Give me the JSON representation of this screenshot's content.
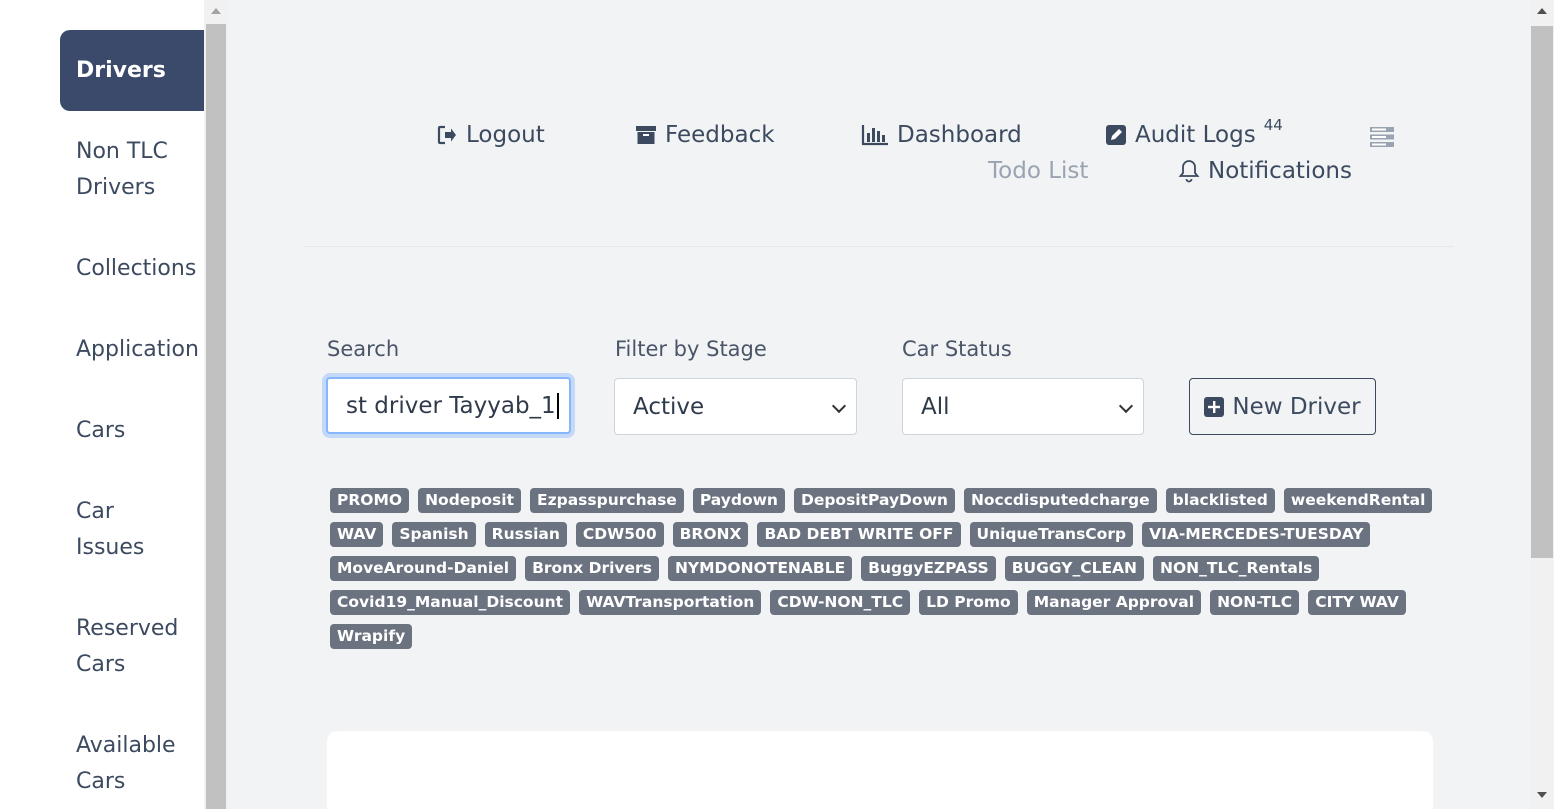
{
  "sidebar": {
    "items": [
      {
        "label": "Drivers",
        "active": true
      },
      {
        "label": "Non TLC Drivers"
      },
      {
        "label": "Collections"
      },
      {
        "label": "Application"
      },
      {
        "label": "Cars"
      },
      {
        "label": "Car Issues"
      },
      {
        "label": "Reserved Cars"
      },
      {
        "label": "Available Cars"
      }
    ]
  },
  "header": {
    "logout": "Logout",
    "feedback": "Feedback",
    "dashboard": "Dashboard",
    "audit_logs": "Audit Logs",
    "audit_logs_count": "44",
    "todo_list": "Todo List",
    "notifications": "Notifications"
  },
  "filters": {
    "search_label": "Search",
    "search_value": "st driver Tayyab_1",
    "stage_label": "Filter by Stage",
    "stage_value": "Active",
    "car_status_label": "Car Status",
    "car_status_value": "All",
    "new_driver": "New Driver"
  },
  "tags": [
    "PROMO",
    "Nodeposit",
    "Ezpasspurchase",
    "Paydown",
    "DepositPayDown",
    "Noccdisputedcharge",
    "blacklisted",
    "weekendRental",
    "WAV",
    "Spanish",
    "Russian",
    "CDW500",
    "BRONX",
    "BAD DEBT WRITE OFF",
    "UniqueTransCorp",
    "VIA-MERCEDES-TUESDAY",
    "MoveAround-Daniel",
    "Bronx Drivers",
    "NYMDONOTENABLE",
    "BuggyEZPASS",
    "BUGGY_CLEAN",
    "NON_TLC_Rentals",
    "Covid19_Manual_Discount",
    "WAVTransportation ",
    "CDW-NON_TLC",
    "LD Promo",
    "Manager Approval",
    "NON-TLC",
    "CITY WAV",
    "Wrapify"
  ],
  "icons": {
    "logout": "logout-icon",
    "feedback": "archive-icon",
    "dashboard": "bar-chart-icon",
    "audit": "edit-icon",
    "menu": "server-icon",
    "bell": "bell-icon",
    "plus": "plus-square-icon"
  },
  "colors": {
    "sidebar_active": "#3b4a6b",
    "tag_bg": "#6b7280",
    "main_bg": "#f2f3f5"
  }
}
